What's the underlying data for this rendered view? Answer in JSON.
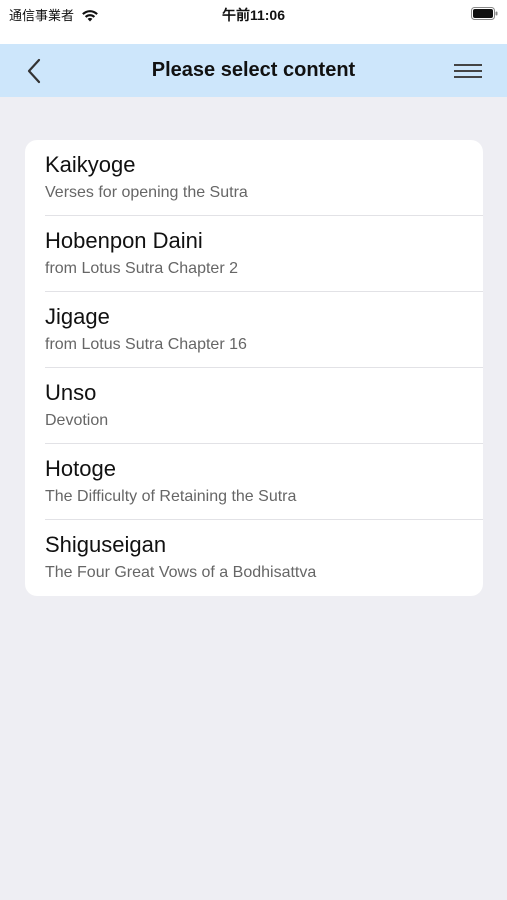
{
  "status_bar": {
    "carrier": "通信事業者",
    "time": "午前11:06",
    "icons": [
      "wifi-icon",
      "battery-icon"
    ]
  },
  "nav": {
    "title": "Please select content",
    "back_icon": "chevron-left-icon",
    "menu_icon": "hamburger-menu-icon",
    "background_color": "#cde6fb"
  },
  "items": [
    {
      "title": "Kaikyoge",
      "subtitle": "Verses for opening the Sutra"
    },
    {
      "title": "Hobenpon Daini",
      "subtitle": "from Lotus Sutra Chapter 2"
    },
    {
      "title": "Jigage",
      "subtitle": "from Lotus Sutra Chapter 16"
    },
    {
      "title": "Unso",
      "subtitle": "Devotion"
    },
    {
      "title": "Hotoge",
      "subtitle": "The Difficulty of Retaining the Sutra"
    },
    {
      "title": "Shiguseigan",
      "subtitle": "The Four Great Vows of a Bodhisattva"
    }
  ]
}
